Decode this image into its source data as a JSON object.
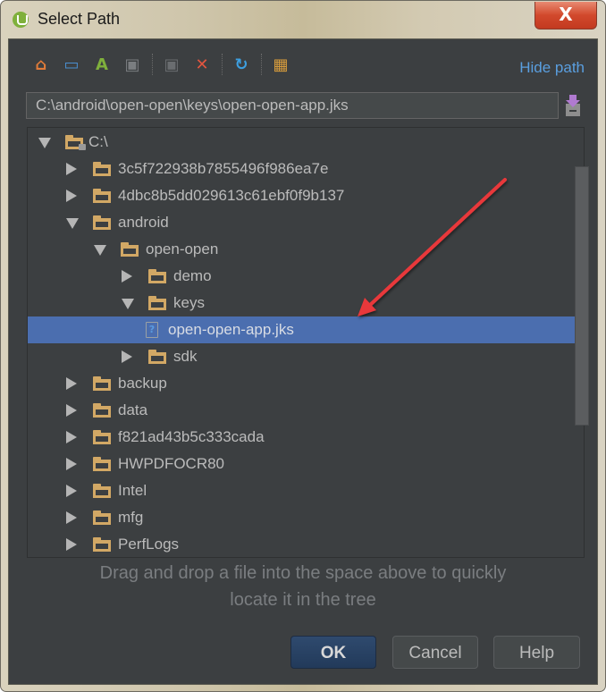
{
  "window": {
    "title": "Select Path",
    "close_label": "X"
  },
  "toolbar": {
    "buttons": [
      {
        "icon": "home-icon",
        "glyph": "⌂",
        "color": "#e07b39"
      },
      {
        "icon": "desktop-icon",
        "glyph": "▭",
        "color": "#4a8fd0"
      },
      {
        "icon": "android-project-icon",
        "glyph": "A",
        "color": "#7fb03c"
      },
      {
        "icon": "new-folder-icon",
        "glyph": "▣",
        "color": "#7a7d80"
      },
      {
        "icon": "delete-folder-icon",
        "glyph": "▣",
        "color": "#6a6d70"
      },
      {
        "icon": "delete-icon",
        "glyph": "✕",
        "color": "#e0553f"
      },
      {
        "icon": "refresh-icon",
        "glyph": "↻",
        "color": "#3d9fe0"
      },
      {
        "icon": "show-hidden-icon",
        "glyph": "▦",
        "color": "#d69b3c"
      }
    ],
    "hide_path_label": "Hide path"
  },
  "path": {
    "value": "C:\\android\\open-open\\keys\\open-open-app.jks"
  },
  "tree": {
    "rows": [
      {
        "label": "C:\\",
        "depth": 0,
        "state": "expanded",
        "type": "drive",
        "selected": false
      },
      {
        "label": "3c5f722938b7855496f986ea7e",
        "depth": 1,
        "state": "collapsed",
        "type": "folder",
        "selected": false
      },
      {
        "label": "4dbc8b5dd029613c61ebf0f9b137",
        "depth": 1,
        "state": "collapsed",
        "type": "folder",
        "selected": false
      },
      {
        "label": "android",
        "depth": 1,
        "state": "expanded",
        "type": "folder",
        "selected": false
      },
      {
        "label": "open-open",
        "depth": 2,
        "state": "expanded",
        "type": "folder",
        "selected": false
      },
      {
        "label": "demo",
        "depth": 3,
        "state": "collapsed",
        "type": "folder",
        "selected": false
      },
      {
        "label": "keys",
        "depth": 3,
        "state": "expanded",
        "type": "folder",
        "selected": false
      },
      {
        "label": "open-open-app.jks",
        "depth": 4,
        "state": "leaf",
        "type": "file",
        "selected": true
      },
      {
        "label": "sdk",
        "depth": 3,
        "state": "collapsed",
        "type": "folder",
        "selected": false
      },
      {
        "label": "backup",
        "depth": 1,
        "state": "collapsed",
        "type": "folder",
        "selected": false
      },
      {
        "label": "data",
        "depth": 1,
        "state": "collapsed",
        "type": "folder",
        "selected": false
      },
      {
        "label": "f821ad43b5c333cada",
        "depth": 1,
        "state": "collapsed",
        "type": "folder",
        "selected": false
      },
      {
        "label": "HWPDFOCR80",
        "depth": 1,
        "state": "collapsed",
        "type": "folder",
        "selected": false
      },
      {
        "label": "Intel",
        "depth": 1,
        "state": "collapsed",
        "type": "folder",
        "selected": false
      },
      {
        "label": "mfg",
        "depth": 1,
        "state": "collapsed",
        "type": "folder",
        "selected": false
      },
      {
        "label": "PerfLogs",
        "depth": 1,
        "state": "collapsed",
        "type": "folder",
        "selected": false
      }
    ]
  },
  "hint": {
    "line1": "Drag and drop a file into the space above to quickly",
    "line2": "locate it in the tree"
  },
  "buttons": {
    "ok": "OK",
    "cancel": "Cancel",
    "help": "Help"
  },
  "colors": {
    "background": "#3c3f41",
    "selection": "#4b6eaf",
    "link": "#5a9fe0",
    "folder": "#d2a865",
    "annotation_arrow": "#e8383a"
  },
  "annotation": {
    "type": "arrow",
    "points_to": "open-open-app.jks"
  }
}
